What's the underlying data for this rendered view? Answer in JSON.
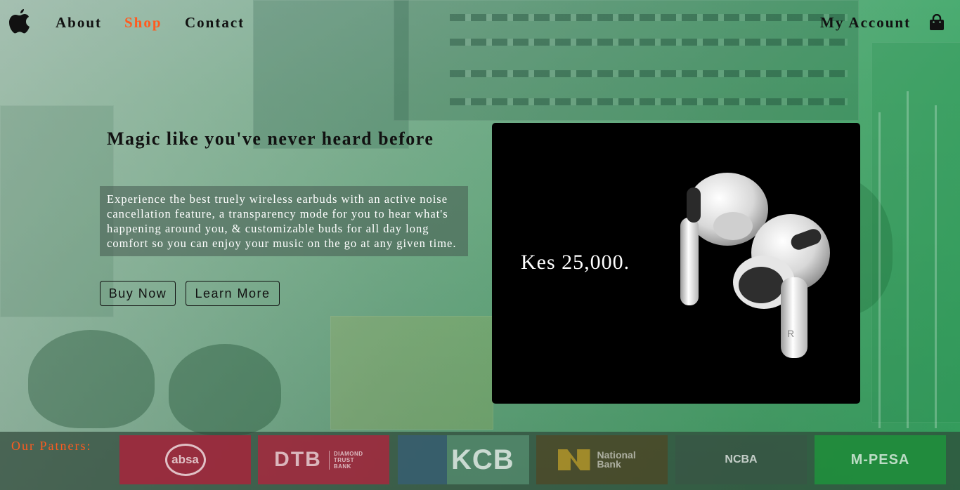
{
  "nav": {
    "links": [
      {
        "label": "About"
      },
      {
        "label": "Shop",
        "active": true
      },
      {
        "label": "Contact"
      }
    ],
    "account_label": "My Account",
    "icons": {
      "logo": "apple-logo-icon",
      "cart": "shopping-bag-icon"
    }
  },
  "hero": {
    "title": "Magic like you've never heard before",
    "description": "Experience the best truely wireless earbuds with an active noise cancellation feature, a transparency mode for you to hear what's happening around you, & customizable buds for all day long comfort so you can enjoy your music on the go at any given time.",
    "buy_label": "Buy Now",
    "learn_label": "Learn More"
  },
  "product": {
    "price": "Kes 25,000.",
    "earbud_mark": "R"
  },
  "partners": {
    "label": "Our Patners:",
    "logos": [
      {
        "name": "absa",
        "text": "absa"
      },
      {
        "name": "dtb",
        "text": "DTB",
        "sub": "DIAMOND TRUST BANK"
      },
      {
        "name": "kcb",
        "text": "KCB"
      },
      {
        "name": "national-bank",
        "text": "National Bank"
      },
      {
        "name": "ncba",
        "text": "NCBA"
      },
      {
        "name": "mpesa",
        "text": "M-PESA"
      }
    ]
  },
  "colors": {
    "accent": "#ff5b1f",
    "text": "#111111",
    "card_bg": "#000000"
  }
}
